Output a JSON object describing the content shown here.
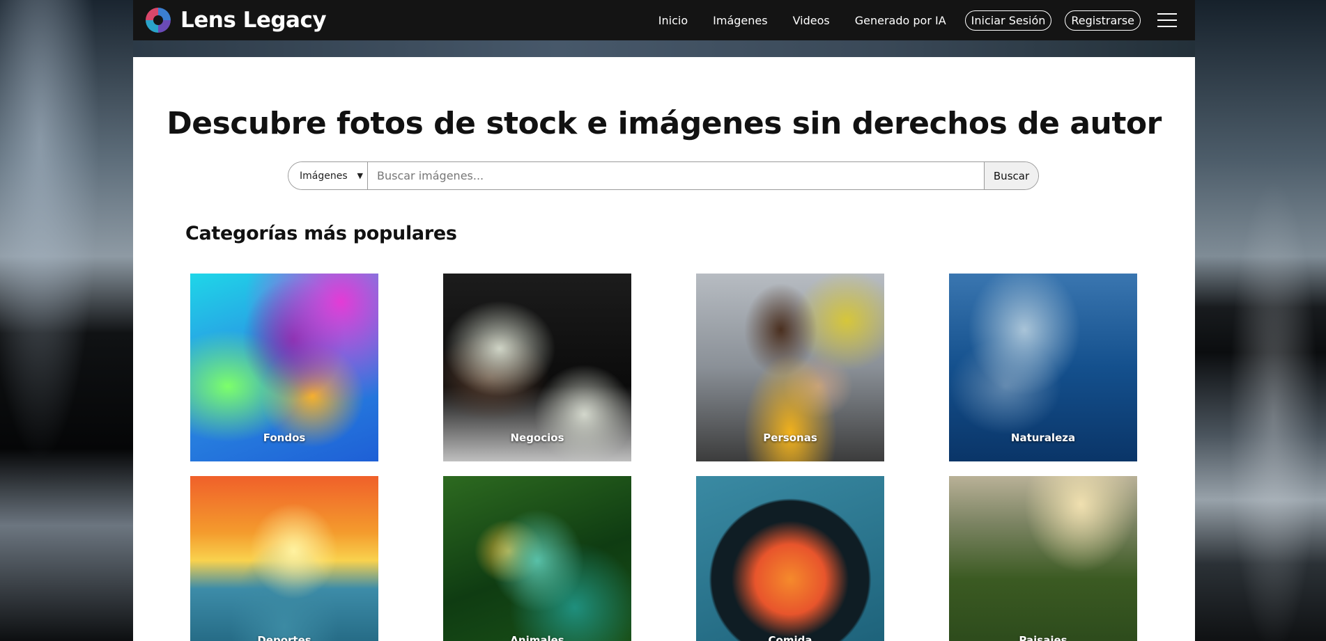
{
  "brand": {
    "name": "Lens Legacy"
  },
  "nav": {
    "links": [
      "Inicio",
      "Imágenes",
      "Videos",
      "Generado por IA"
    ],
    "login_label": "Iniciar Sesión",
    "register_label": "Registrarse",
    "menu_icon": "hamburger-menu-icon"
  },
  "hero": {
    "title": "Descubre fotos de stock e imágenes sin derechos de autor"
  },
  "search": {
    "type_selected": "Imágenes",
    "placeholder": "Buscar imágenes...",
    "value": "",
    "button_label": "Buscar"
  },
  "categories": {
    "title": "Categorías más populares",
    "items": [
      {
        "label": "Fondos"
      },
      {
        "label": "Negocios"
      },
      {
        "label": "Personas"
      },
      {
        "label": "Naturaleza"
      },
      {
        "label": "Deportes"
      },
      {
        "label": "Animales"
      },
      {
        "label": "Comida"
      },
      {
        "label": "Paisajes"
      }
    ]
  },
  "colors": {
    "navbar_bg": "#141414",
    "panel_bg": "#ffffff",
    "text_primary": "#111111"
  }
}
